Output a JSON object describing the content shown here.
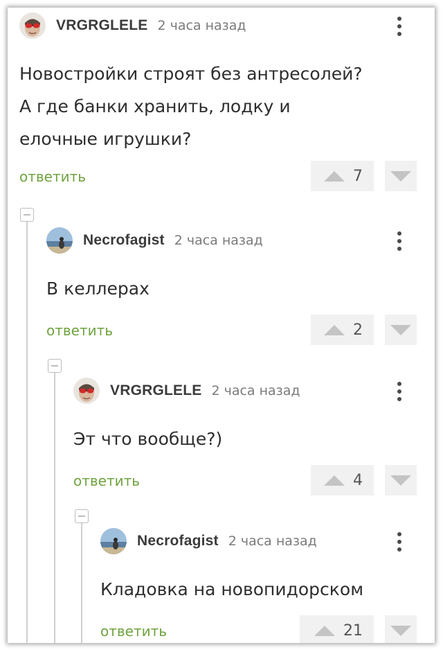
{
  "comments": [
    {
      "username": "VRGRGLELE",
      "time": "2 часа назад",
      "lines": [
        "Новостройки строят без антресолей?",
        "А где банки хранить, лодку и",
        "елочные игрушки?"
      ],
      "reply_label": "ответить",
      "score": "7",
      "avatar": "sunglasses-avatar"
    },
    {
      "username": "Necrofagist",
      "time": "2 часа назад",
      "lines": [
        "В келлерах"
      ],
      "reply_label": "ответить",
      "score": "2",
      "avatar": "beach-avatar"
    },
    {
      "username": "VRGRGLELE",
      "time": "2 часа назад",
      "lines": [
        "Эт что вообще?)"
      ],
      "reply_label": "ответить",
      "score": "4",
      "avatar": "sunglasses-avatar"
    },
    {
      "username": "Necrofagist",
      "time": "2 часа назад",
      "lines": [
        "Кладовка на новопидорском"
      ],
      "reply_label": "ответить",
      "score": "21",
      "avatar": "beach-avatar"
    }
  ],
  "colors": {
    "reply_link": "#6fa23f",
    "vote_bg": "#f1f1f1",
    "vote_arrow": "#c4c4c4"
  },
  "icons": [
    "more-vertical-icon",
    "upvote-arrow-icon",
    "downvote-arrow-icon",
    "collapse-minus-icon"
  ]
}
